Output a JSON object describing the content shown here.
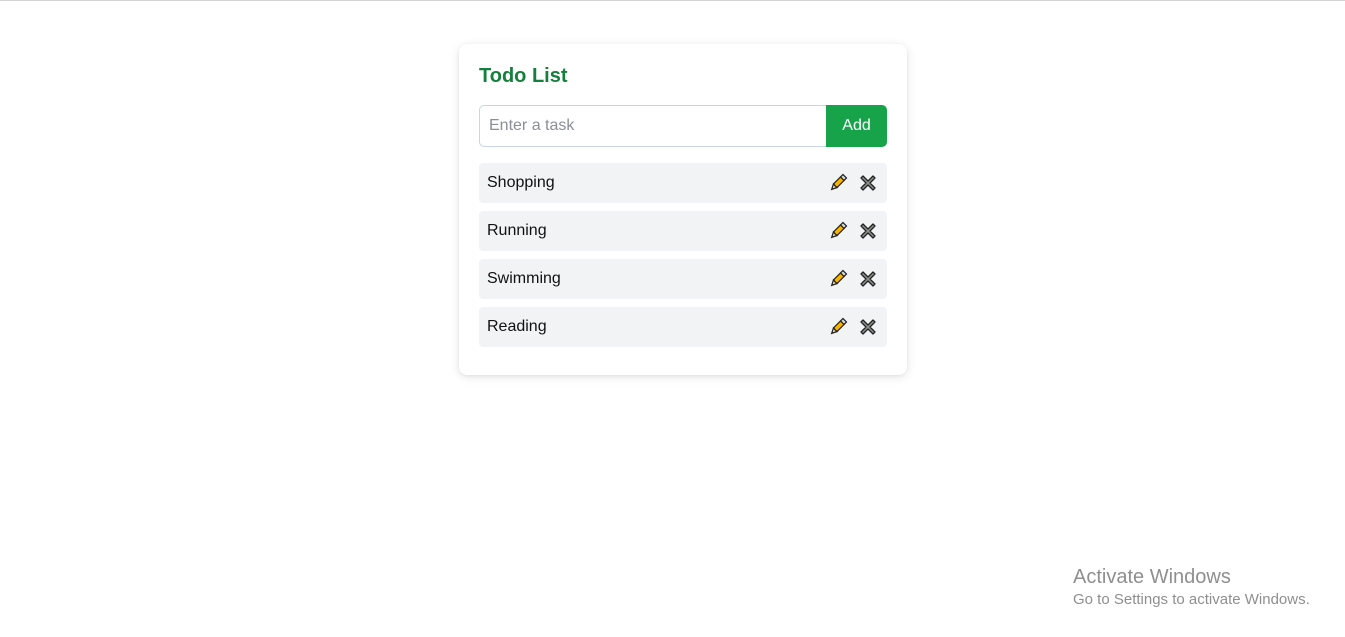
{
  "app": {
    "title": "Todo List"
  },
  "input": {
    "placeholder": "Enter a task",
    "value": ""
  },
  "add_button": {
    "label": "Add"
  },
  "tasks": [
    {
      "text": "Shopping",
      "edit_icon": "pencil-icon",
      "delete_icon": "cross-icon"
    },
    {
      "text": "Running",
      "edit_icon": "pencil-icon",
      "delete_icon": "cross-icon"
    },
    {
      "text": "Swimming",
      "edit_icon": "pencil-icon",
      "delete_icon": "cross-icon"
    },
    {
      "text": "Reading",
      "edit_icon": "pencil-icon",
      "delete_icon": "cross-icon"
    }
  ],
  "watermark": {
    "line1": "Activate Windows",
    "line2": "Go to Settings to activate Windows."
  },
  "colors": {
    "title": "#15803d",
    "accent": "#16a34a",
    "item_background": "#f2f3f5"
  }
}
